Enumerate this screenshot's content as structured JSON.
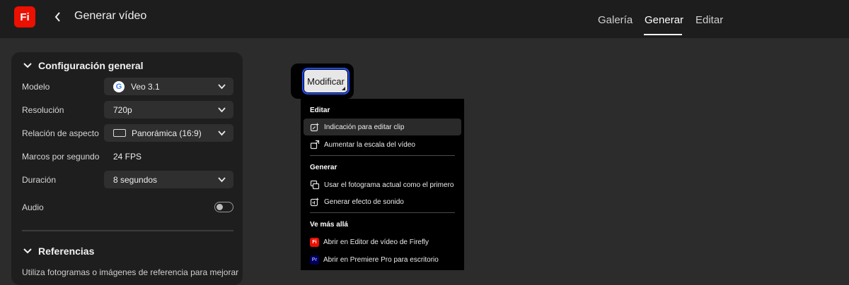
{
  "app": {
    "logo_text": "Fi",
    "brand_color": "#eb1000",
    "title": "Generar vídeo"
  },
  "nav": {
    "tabs": [
      {
        "label": "Galería"
      },
      {
        "label": "Generar",
        "active": true
      },
      {
        "label": "Editar"
      }
    ]
  },
  "panel": {
    "general_title": "Configuración general",
    "rows": {
      "model_label": "Modelo",
      "model_value": "Veo 3.1",
      "model_icon": "google-icon",
      "resolution_label": "Resolución",
      "resolution_value": "720p",
      "aspect_label": "Relación de aspecto",
      "aspect_value": "Panorámica (16:9)",
      "fps_label": "Marcos por segundo",
      "fps_value": "24 FPS",
      "duration_label": "Duración",
      "duration_value": "8 segundos",
      "audio_label": "Audio",
      "audio_on": false
    },
    "references_title": "Referencias",
    "references_text": "Utiliza fotogramas o imágenes de referencia para mejorar"
  },
  "modify_button": {
    "label": "Modificar"
  },
  "menu": {
    "edit_header": "Editar",
    "edit_items": [
      {
        "label": "Indicación para editar clip",
        "icon": "sparkle-edit-icon"
      },
      {
        "label": "Aumentar la escala del vídeo",
        "icon": "upscale-icon"
      }
    ],
    "generate_header": "Generar",
    "generate_items": [
      {
        "label": "Usar el fotograma actual como el primero",
        "icon": "frame-icon"
      },
      {
        "label": "Generar efecto de sonido",
        "icon": "sound-sparkle-icon"
      }
    ],
    "beyond_header": "Ve más allá",
    "beyond_items": [
      {
        "label": "Abrir en Editor de vídeo de Firefly",
        "badge": "Fi",
        "badge_color": "#eb1000"
      },
      {
        "label": "Abrir en Premiere Pro para escritorio",
        "badge": "Pr",
        "badge_color": "#00005b"
      }
    ]
  }
}
